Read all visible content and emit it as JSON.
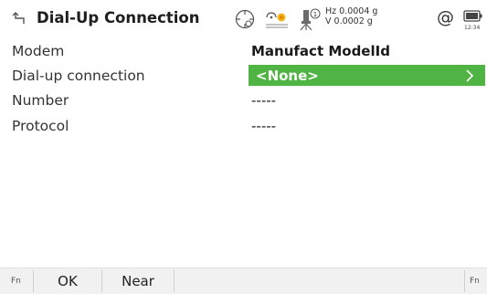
{
  "header": {
    "title": "Dial-Up Connection",
    "back_icon": "back-arrow-icon",
    "hz_label": "Hz 0.0004 g",
    "v_label": "V  0.0002 g",
    "at_symbol": "@",
    "time": "12:34"
  },
  "form": {
    "rows": [
      {
        "label": "Modem",
        "value": "Manufact ModelId"
      },
      {
        "label": "Dial-up connection",
        "value": "<None>"
      },
      {
        "label": "Number",
        "value": "-----"
      },
      {
        "label": "Protocol",
        "value": "-----"
      }
    ]
  },
  "softkeys": {
    "fn_left": "Fn",
    "ok": "OK",
    "near": "Near",
    "fn_right": "Fn"
  },
  "colors": {
    "accent": "#4fb443",
    "softbar_bg": "#f1f1f1",
    "background": "#ffffff"
  }
}
